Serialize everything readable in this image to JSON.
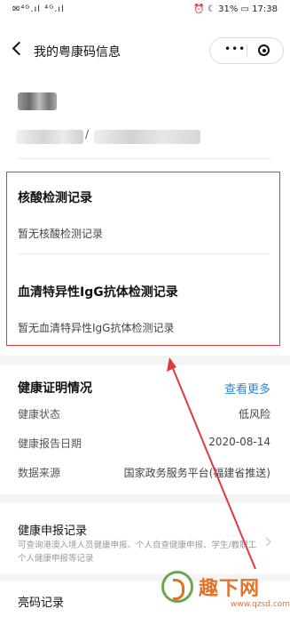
{
  "status_bar": {
    "signal": "✉⁴ᴳ.ıl ⁴ᴳ.ıl",
    "right": "⏰ ☾ 31% ▭ 17:38"
  },
  "nav": {
    "title": "我的粤康码信息",
    "more": "•••"
  },
  "identity": {
    "separator": "/"
  },
  "records": {
    "nucleic": {
      "title": "核酸检测记录",
      "empty": "暂无核酸检测记录"
    },
    "antibody": {
      "title": "血清特异性IgG抗体检测记录",
      "empty": "暂无血清特异性IgG抗体检测记录"
    }
  },
  "health": {
    "title": "健康证明情况",
    "view_more": "查看更多",
    "rows": [
      {
        "label": "健康状态",
        "value": "低风险"
      },
      {
        "label": "健康报告日期",
        "value": "2020-08-14"
      },
      {
        "label": "数据来源",
        "value": "国家政务服务平台(福建省推送)"
      }
    ]
  },
  "report": {
    "title": "健康申报记录",
    "desc": "可查询港澳入境人员健康申报、个人自查健康申报、学生/教职工个人健康申报等记录"
  },
  "code_record": {
    "title": "亮码记录"
  },
  "watermark": {
    "brand": "趣下网",
    "url": "www.qzsd.com"
  },
  "colors": {
    "highlight_border": "#e0393b",
    "arrow": "#e0393b",
    "link": "#2f86cd"
  }
}
